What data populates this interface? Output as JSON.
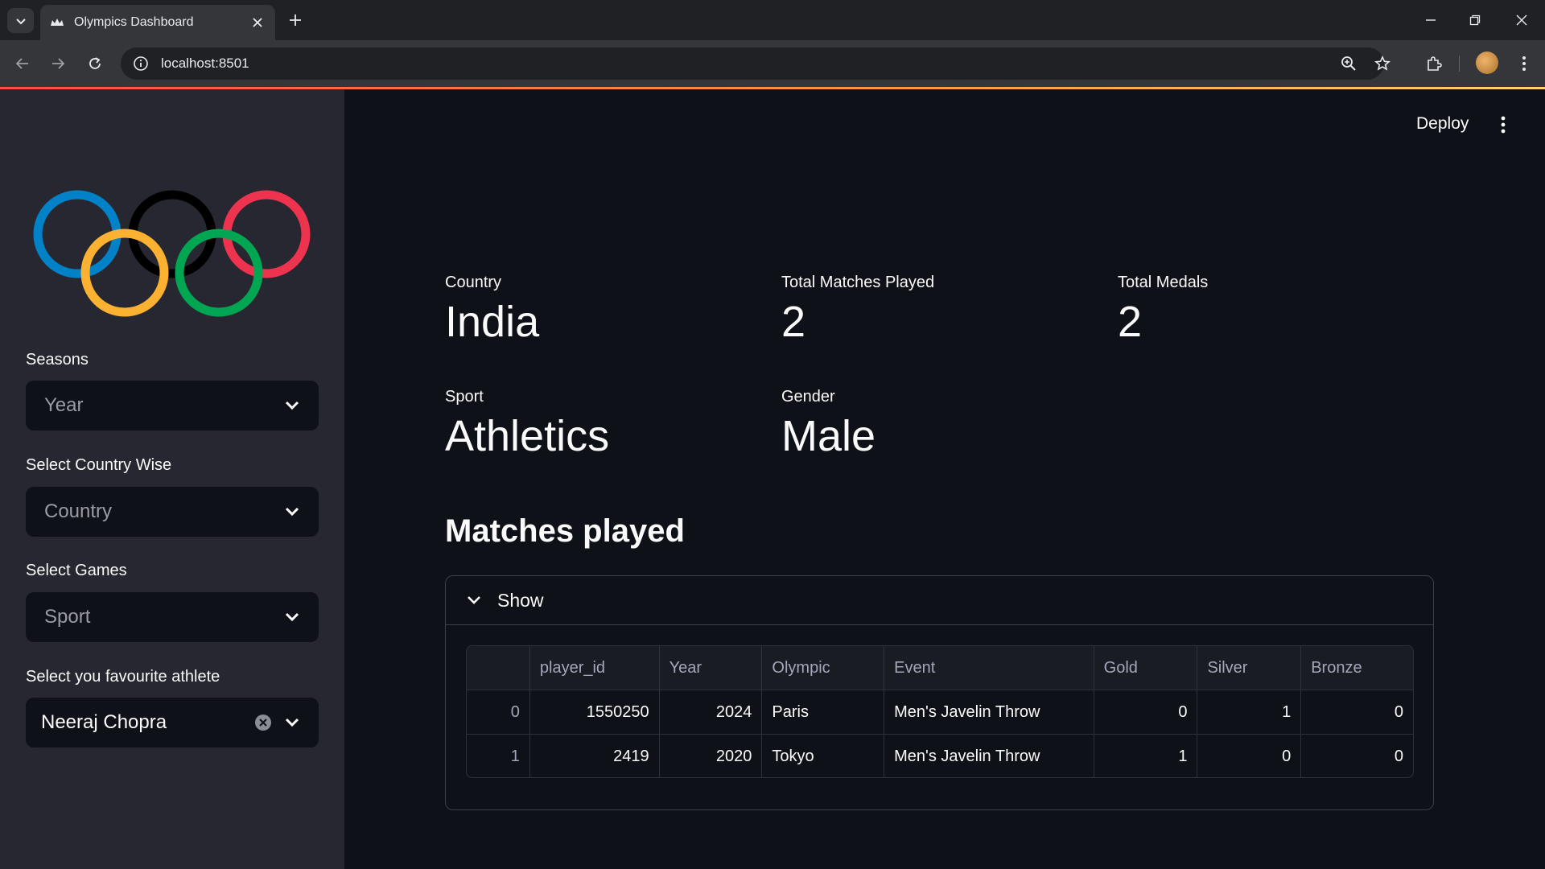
{
  "browser": {
    "tab_title": "Olympics Dashboard",
    "url": "localhost:8501"
  },
  "header": {
    "deploy_label": "Deploy"
  },
  "sidebar": {
    "filters": [
      {
        "label": "Seasons",
        "placeholder": "Year"
      },
      {
        "label": "Select Country Wise",
        "placeholder": "Country"
      },
      {
        "label": "Select Games",
        "placeholder": "Sport"
      },
      {
        "label": "Select you favourite athlete",
        "value": "Neeraj Chopra"
      }
    ]
  },
  "metrics": [
    {
      "label": "Country",
      "value": "India"
    },
    {
      "label": "Total Matches Played",
      "value": "2"
    },
    {
      "label": "Total Medals",
      "value": "2"
    },
    {
      "label": "Sport",
      "value": "Athletics"
    },
    {
      "label": "Gender",
      "value": "Male"
    }
  ],
  "section": {
    "heading": "Matches played",
    "expander_label": "Show"
  },
  "table": {
    "columns": [
      "",
      "player_id",
      "Year",
      "Olympic",
      "Event",
      "Gold",
      "Silver",
      "Bronze"
    ],
    "rows": [
      [
        "0",
        "1550250",
        "2024",
        "Paris",
        "Men's Javelin Throw",
        "0",
        "1",
        "0"
      ],
      [
        "1",
        "2419",
        "2020",
        "Tokyo",
        "Men's Javelin Throw",
        "1",
        "0",
        "0"
      ]
    ]
  },
  "colors": {
    "background": "#0e1117",
    "sidebar": "#262730",
    "accent": "#ff4b4b",
    "rings": [
      "#0081c8",
      "#fcb131",
      "#000000",
      "#00a651",
      "#ee334e"
    ]
  },
  "icons": {
    "favicon": "olympic-rings-icon",
    "expander": "chevron-down-icon",
    "select": "chevron-down-icon",
    "clear": "clear-circle-icon",
    "menu": "vertical-dots-icon"
  }
}
